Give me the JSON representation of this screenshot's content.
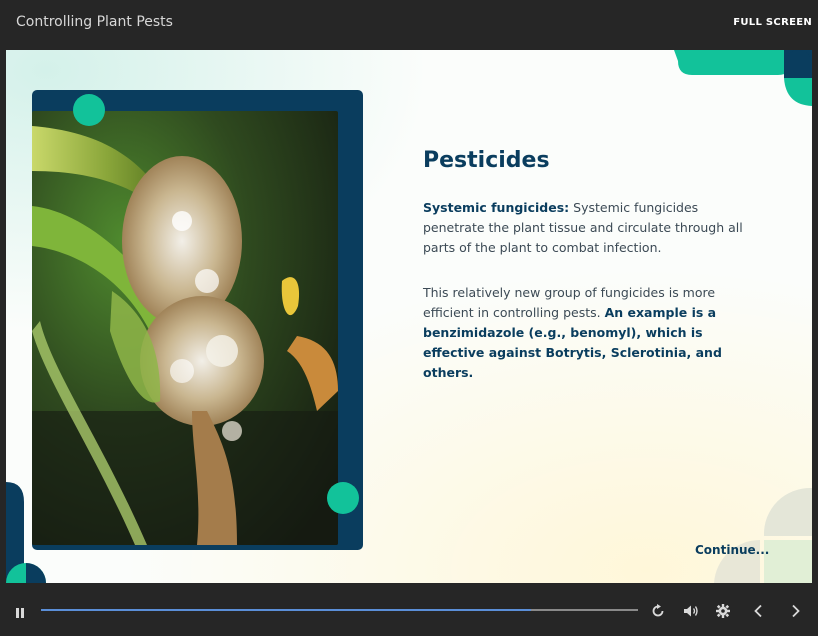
{
  "header": {
    "course_title": "Controlling Plant Pests",
    "fullscreen_label": "FULL SCREEN"
  },
  "slide": {
    "heading": "Pesticides",
    "p1_bold": "Systemic fungicides:",
    "p1_text": " Systemic fungicides penetrate the plant tissue and circulate through all parts of the plant to combat infection.",
    "p2_text": "This relatively new group of fungicides is more efficient in controlling pests. ",
    "p2_bold": "An example is a benzimidazole (e.g., benomyl), which is effective against Botrytis, Sclerotinia, and others.",
    "continue_label": "Continue..."
  },
  "player": {
    "progress": 0.82,
    "icons": [
      "pause-icon",
      "replay-icon",
      "volume-icon",
      "settings-icon",
      "prev-icon",
      "next-icon"
    ]
  },
  "colors": {
    "navy": "#0a3d5e",
    "teal": "#12c29a",
    "progress": "#5b8fd8"
  }
}
